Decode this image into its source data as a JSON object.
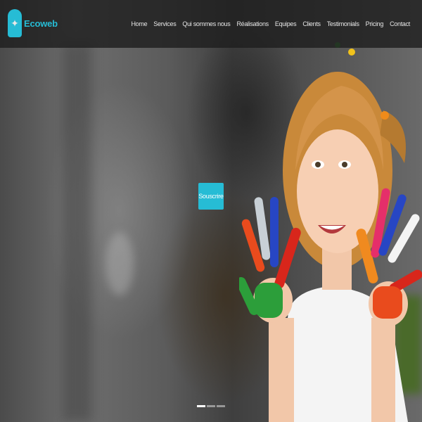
{
  "brand": {
    "name": "Ecoweb",
    "logo_icon": "feather-icon",
    "logo_glyph": "✦"
  },
  "nav": {
    "items": [
      {
        "label": "Home"
      },
      {
        "label": "Services"
      },
      {
        "label": "Qui sommes nous"
      },
      {
        "label": "Réalisations"
      },
      {
        "label": "Equipes"
      },
      {
        "label": "Clients"
      },
      {
        "label": "Testimonials"
      },
      {
        "label": "Pricing"
      },
      {
        "label": "Contact"
      }
    ]
  },
  "hero": {
    "cta_label": "Souscrire",
    "slides_total": 3,
    "slide_active": 1
  },
  "colors": {
    "accent": "#26bcd5",
    "navbar": "#1e1e1e",
    "nav_text": "#e6e6e6"
  }
}
